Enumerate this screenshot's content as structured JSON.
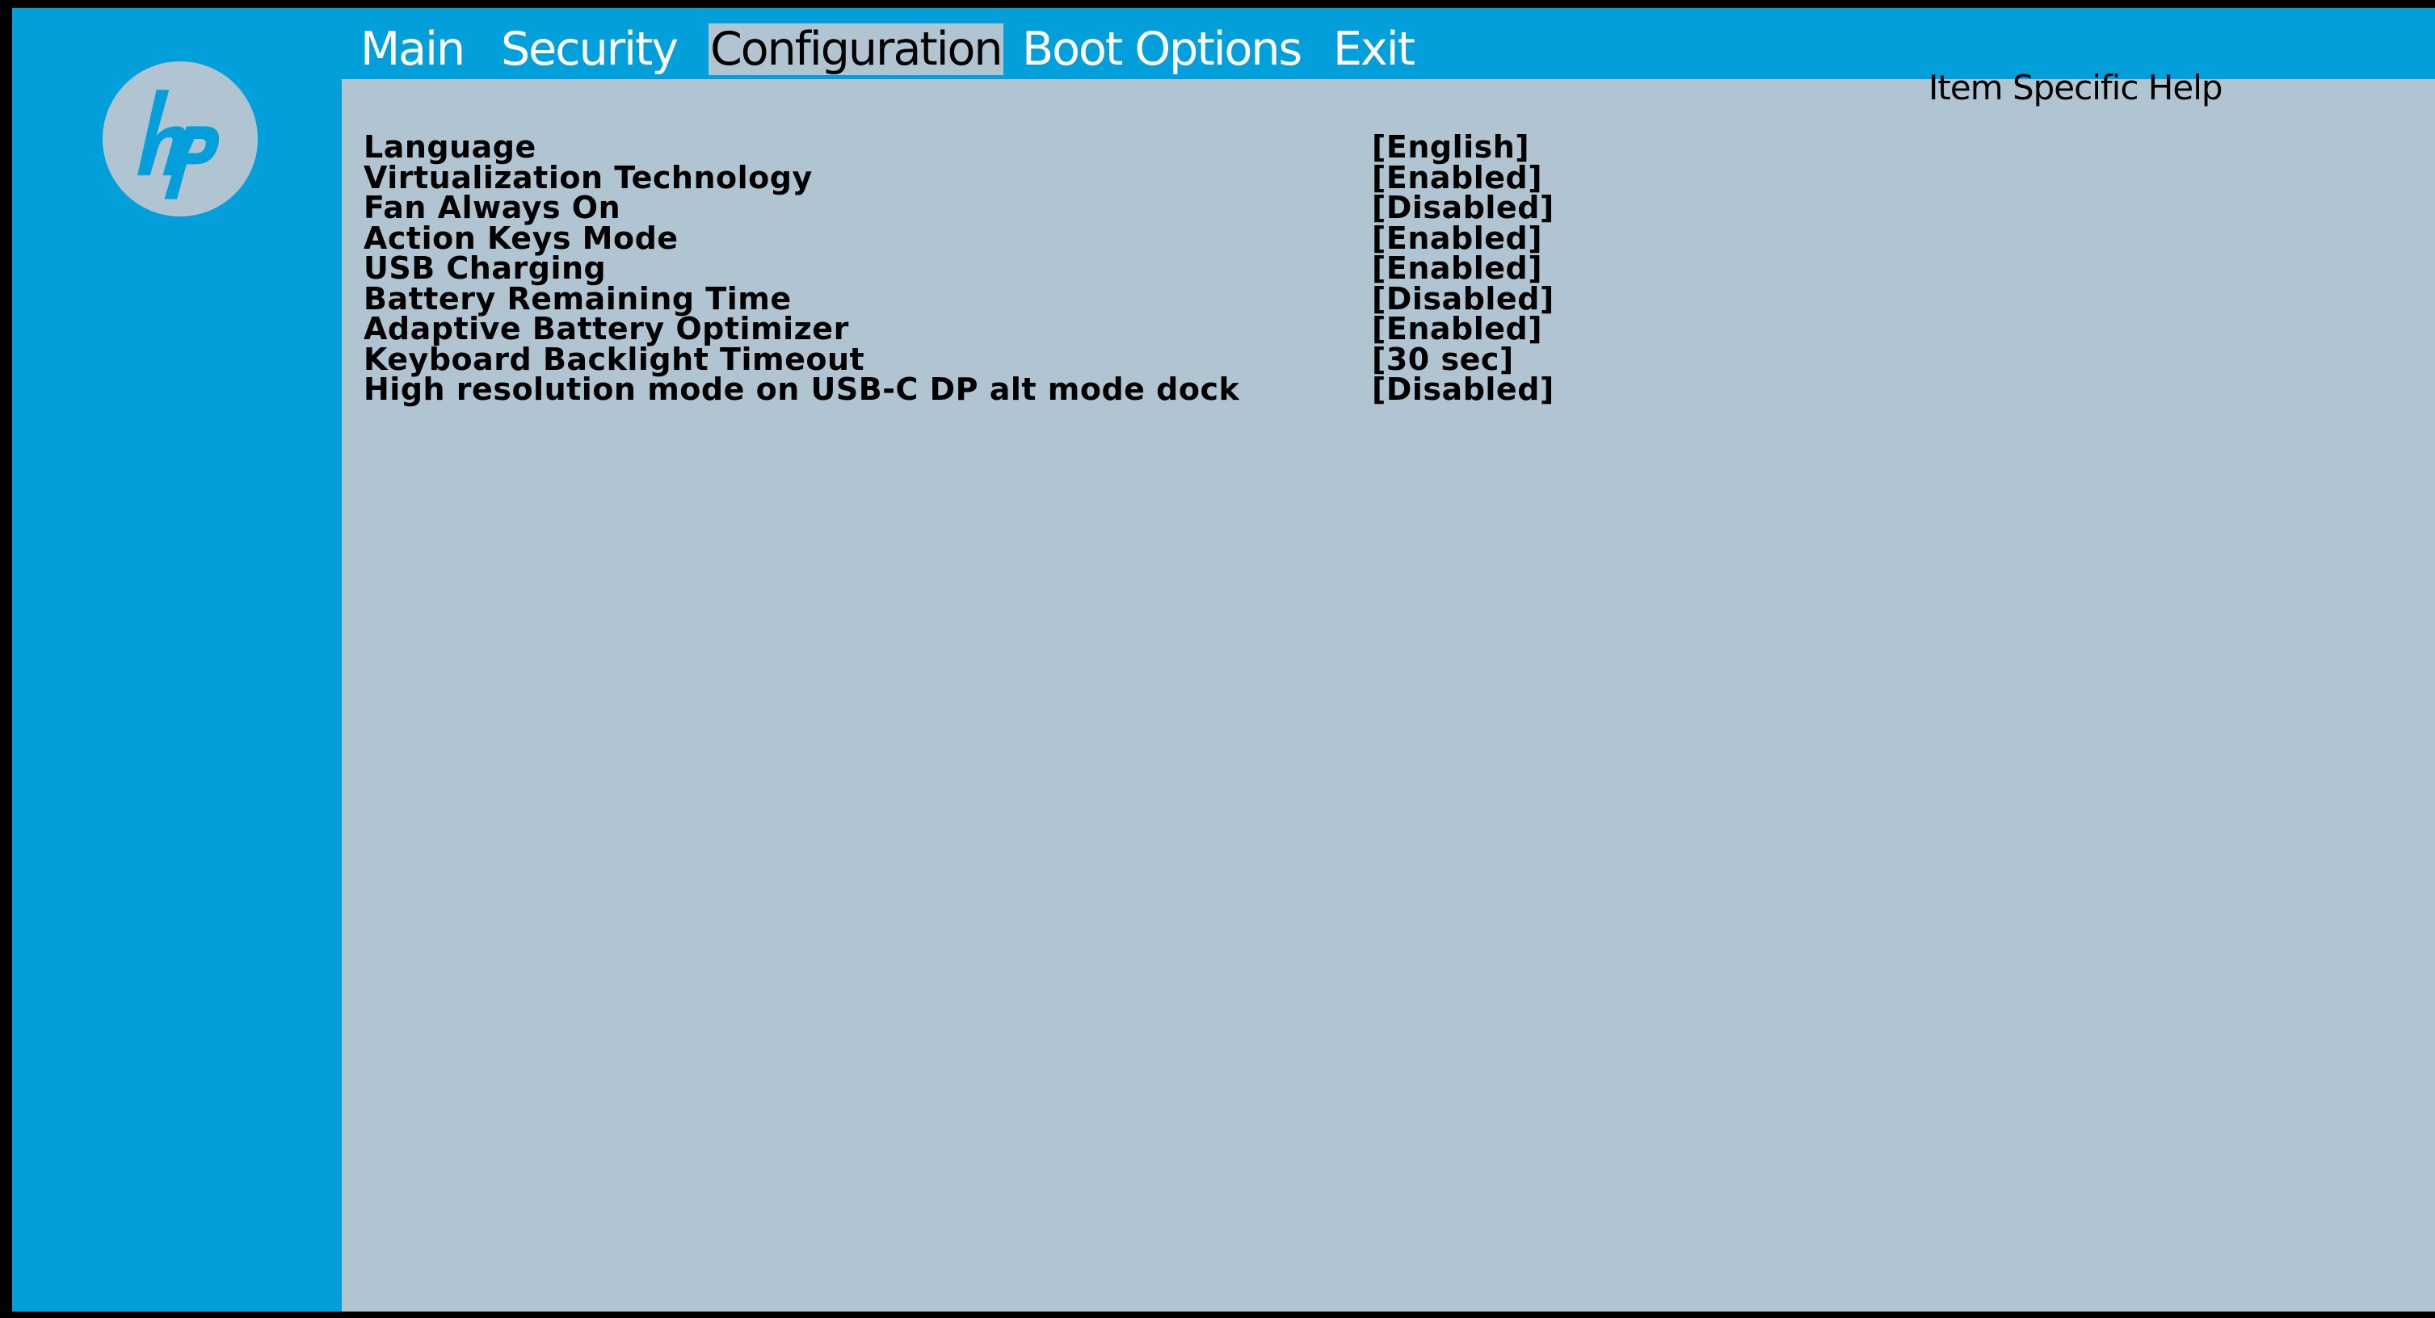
{
  "brand": {
    "logo_text": "hp",
    "logo_icon": "hp-logo-icon",
    "accent_color": "#029fdb",
    "panel_color": "#b0c5d1"
  },
  "menu": {
    "tabs": [
      {
        "label": "Main",
        "active": false
      },
      {
        "label": "Security",
        "active": false
      },
      {
        "label": "Configuration",
        "active": true
      },
      {
        "label": "Boot Options",
        "active": false
      },
      {
        "label": "Exit",
        "active": false
      }
    ]
  },
  "help": {
    "title": "Item Specific Help"
  },
  "settings": [
    {
      "label": "Language",
      "value": "[English]"
    },
    {
      "label": "Virtualization Technology",
      "value": "[Enabled]"
    },
    {
      "label": "Fan Always On",
      "value": "[Disabled]"
    },
    {
      "label": "Action Keys Mode",
      "value": "[Enabled]"
    },
    {
      "label": "USB Charging",
      "value": "[Enabled]"
    },
    {
      "label": "Battery Remaining Time",
      "value": "[Disabled]"
    },
    {
      "label": "Adaptive Battery Optimizer",
      "value": "[Enabled]"
    },
    {
      "label": "Keyboard Backlight Timeout",
      "value": "[30 sec]"
    },
    {
      "label": "High resolution mode on USB-C DP alt mode dock",
      "value": "[Disabled]"
    }
  ]
}
